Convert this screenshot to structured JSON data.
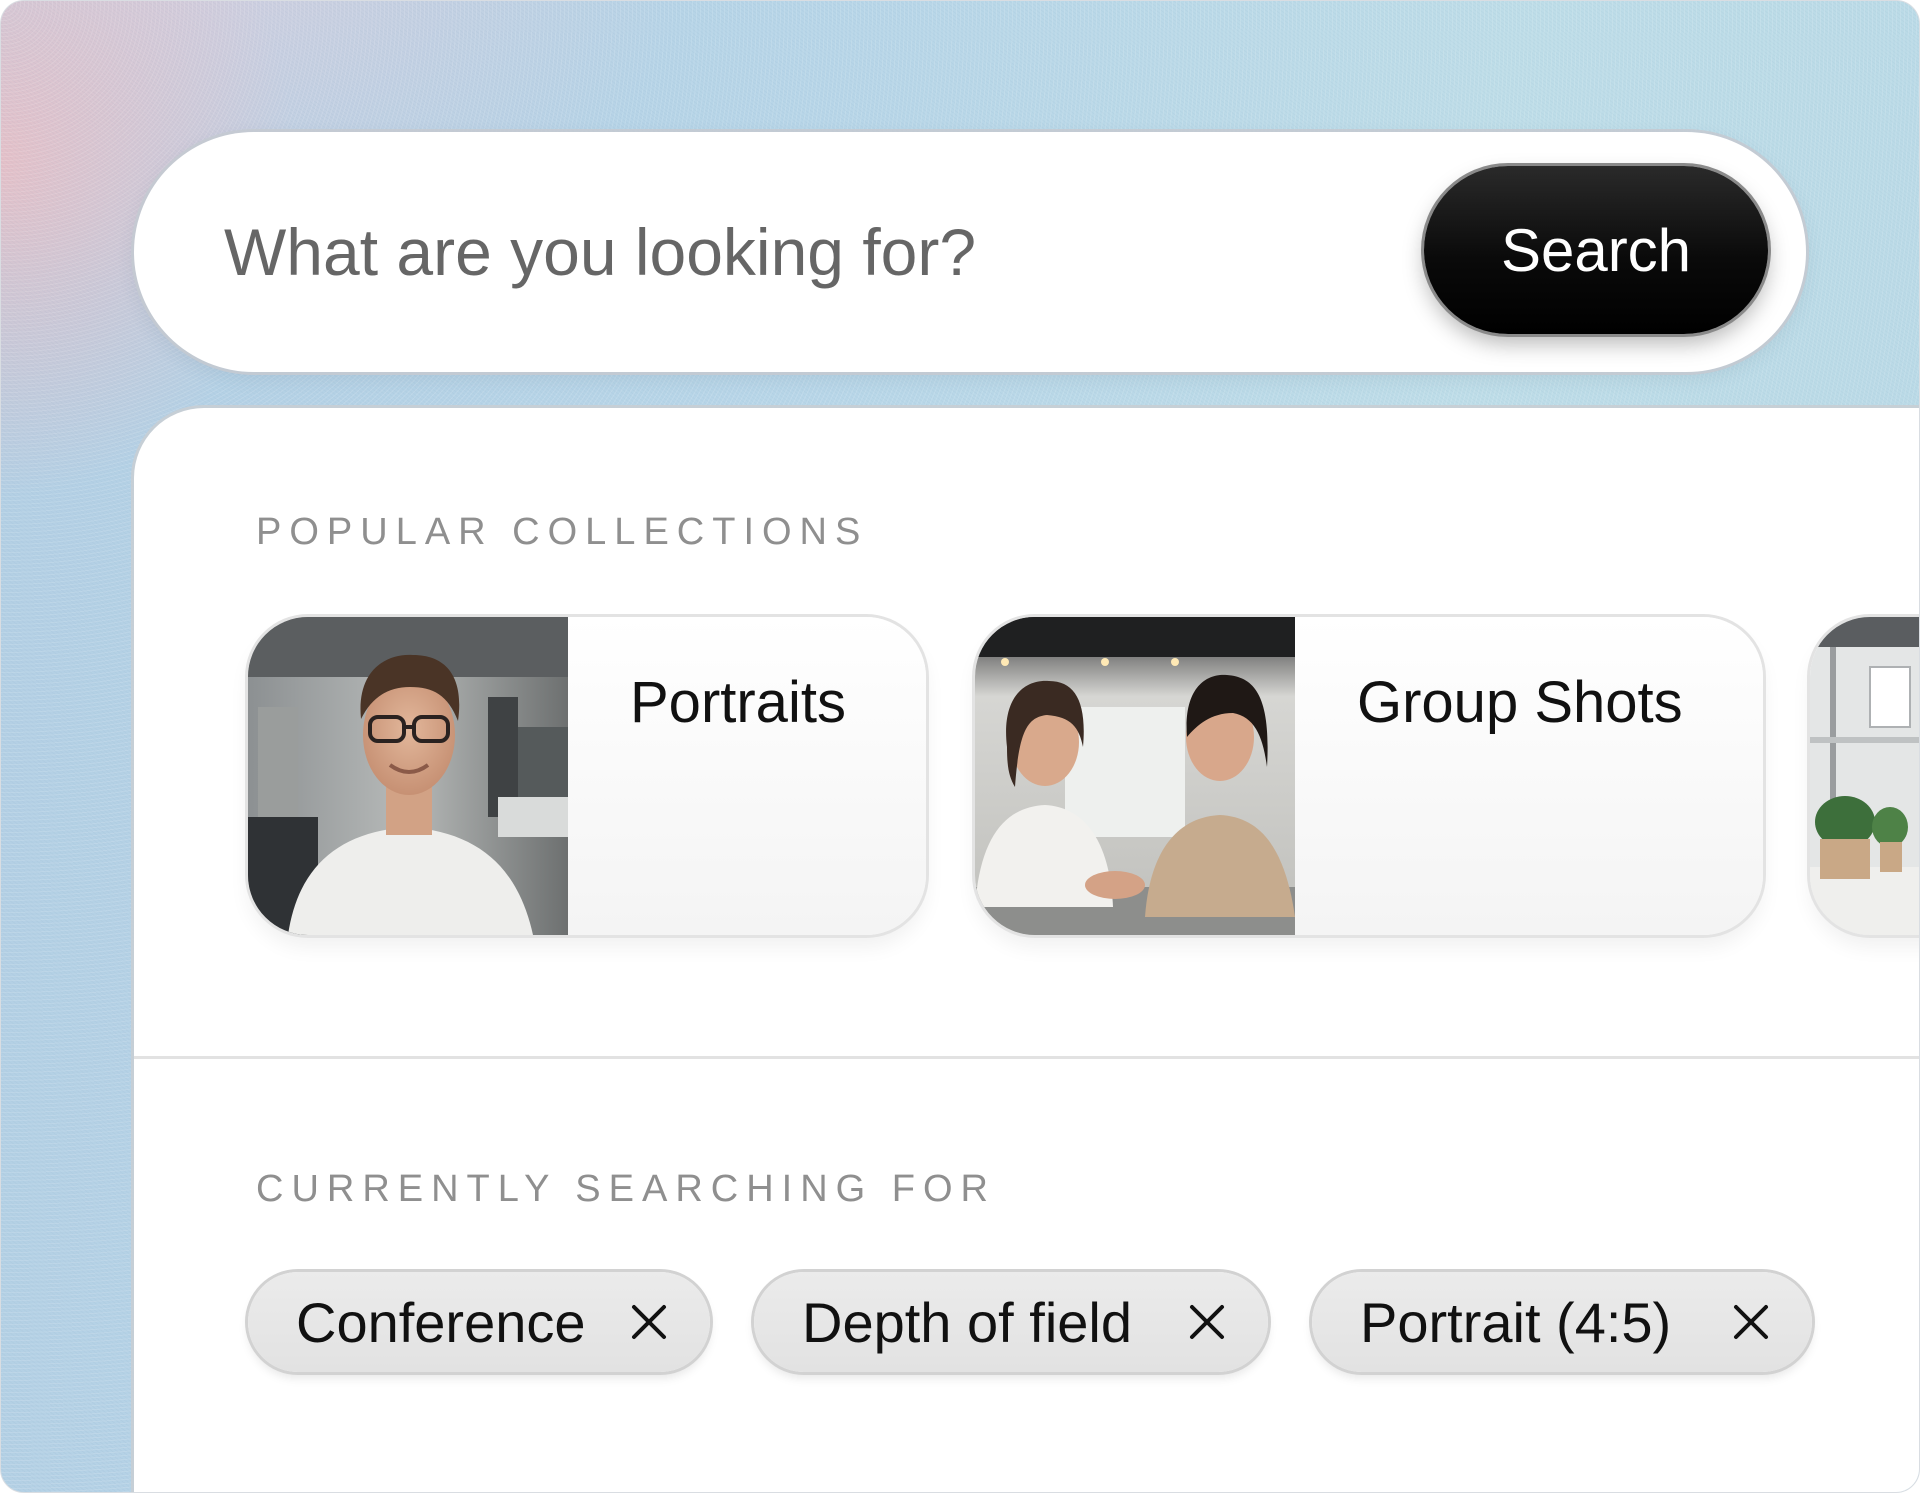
{
  "search": {
    "placeholder": "What are you looking for?",
    "button_label": "Search"
  },
  "popular_collections": {
    "heading": "POPULAR COLLECTIONS",
    "cards": [
      {
        "title": "Portraits",
        "image": "man-with-glasses-portrait"
      },
      {
        "title": "Group Shots",
        "image": "two-women-talking-at-table"
      },
      {
        "title": "",
        "image": "office-interior-with-plants"
      }
    ]
  },
  "current_search": {
    "heading": "CURRENTLY SEARCHING FOR",
    "chips": [
      {
        "label": "Conference",
        "icon": "close-icon"
      },
      {
        "label": "Depth of field",
        "icon": "close-icon"
      },
      {
        "label": "Portrait (4:5)",
        "icon": "close-icon"
      }
    ]
  },
  "colors": {
    "search_button": "#000000",
    "chip_background": "#e6e6e6",
    "label_gray": "#8f8f8f"
  }
}
